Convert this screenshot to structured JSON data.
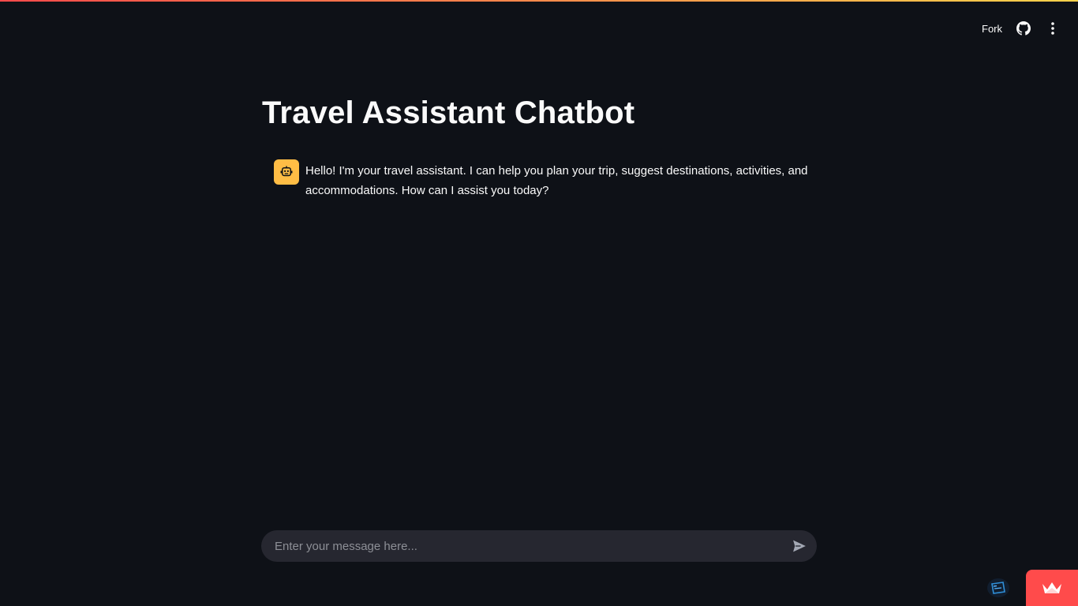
{
  "header": {
    "fork_label": "Fork",
    "github_icon": "github-icon",
    "menu_icon": "vertical-ellipsis-icon"
  },
  "main": {
    "title": "Travel Assistant Chatbot",
    "messages": [
      {
        "role": "assistant",
        "avatar_icon": "robot-icon",
        "text": "Hello! I'm your travel assistant. I can help you plan your trip, suggest destinations, activities, and accommodations. How can I assist you today?"
      }
    ]
  },
  "chat_input": {
    "placeholder": "Enter your message here...",
    "value": "",
    "send_icon": "send-icon"
  },
  "footer": {
    "status_icon": "running-status-icon",
    "hosted_badge_icon": "streamlit-crown-icon"
  },
  "colors": {
    "background": "#0e1117",
    "input_background": "#262730",
    "avatar_background": "#ffbd45",
    "badge_background": "#ff4b4b",
    "top_gradient": [
      "#ff4b4b",
      "#ffd34b"
    ]
  }
}
